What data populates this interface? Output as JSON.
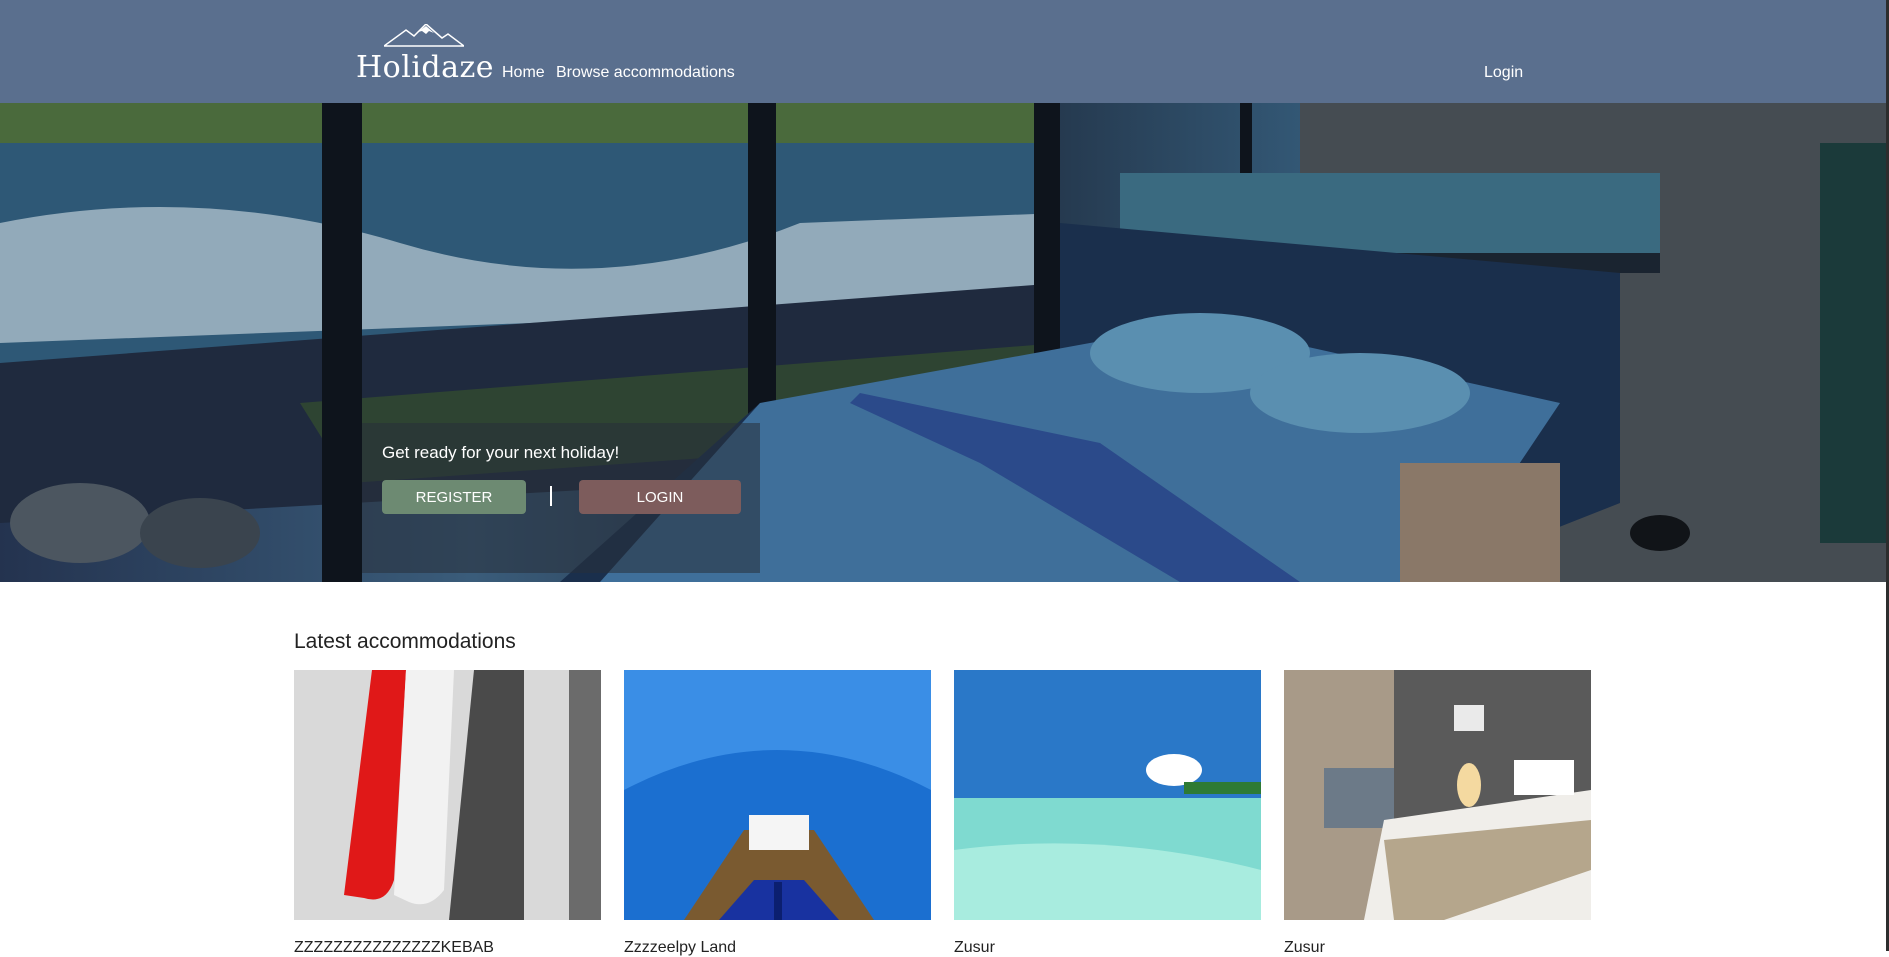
{
  "header": {
    "logo_text": "Holidaze",
    "nav": {
      "home": "Home",
      "browse": "Browse accommodations",
      "login": "Login"
    }
  },
  "hero": {
    "tagline": "Get ready for your next holiday!",
    "register_label": "REGISTER",
    "login_label": "LOGIN",
    "divider": "|"
  },
  "latest": {
    "title": "Latest accommodations",
    "cards": [
      {
        "name": "ZZZZZZZZZZZZZZZKEBAB"
      },
      {
        "name": "Zzzzeelpy Land"
      },
      {
        "name": "Zusur"
      },
      {
        "name": "Zusur"
      }
    ]
  },
  "colors": {
    "header_bg": "#5a6f8e",
    "register_btn": "#6d8a72",
    "login_btn": "#7d5c5c"
  }
}
